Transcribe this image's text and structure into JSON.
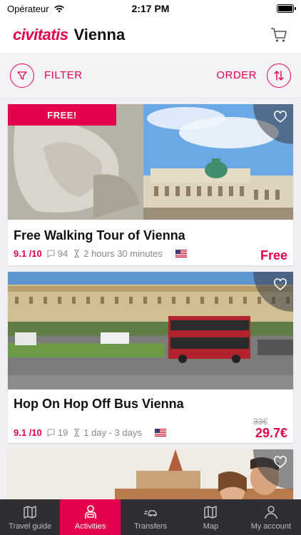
{
  "status_bar": {
    "carrier": "Opérateur",
    "time": "2:17 PM"
  },
  "header": {
    "brand": "civitatis",
    "city": "Vienna",
    "cart_icon": "cart-icon"
  },
  "toolbar": {
    "filter_label": "FILTER",
    "order_label": "ORDER",
    "filter_icon": "funnel-icon",
    "order_icon": "sort-arrows-icon"
  },
  "activities": [
    {
      "badge": "FREE!",
      "title": "Free Walking Tour of Vienna",
      "rating": "9.1 /10",
      "reviews": "94",
      "duration": "2 hours 30 minutes",
      "language_flag": "us-flag-icon",
      "price": "Free",
      "old_price": ""
    },
    {
      "badge": "",
      "title": "Hop On Hop Off Bus Vienna",
      "rating": "9.1 /10",
      "reviews": "19",
      "duration": "1 day - 3 days",
      "language_flag": "us-flag-icon",
      "price": "29.7€",
      "old_price": "33€"
    },
    {
      "badge": "",
      "title": "",
      "rating": "",
      "reviews": "",
      "duration": "",
      "price": "",
      "old_price": ""
    }
  ],
  "tab_bar": {
    "tabs": [
      {
        "label": "Travel guide",
        "icon": "map-book-icon",
        "active": false
      },
      {
        "label": "Activities",
        "icon": "person-icon",
        "active": true
      },
      {
        "label": "Transfers",
        "icon": "car-icon",
        "active": false
      },
      {
        "label": "Map",
        "icon": "map-icon",
        "active": false
      },
      {
        "label": "My account",
        "icon": "user-icon",
        "active": false
      }
    ]
  },
  "colors": {
    "accent": "#e6004c",
    "tab_bar_bg": "#2e2e33",
    "background": "#efeff4"
  }
}
